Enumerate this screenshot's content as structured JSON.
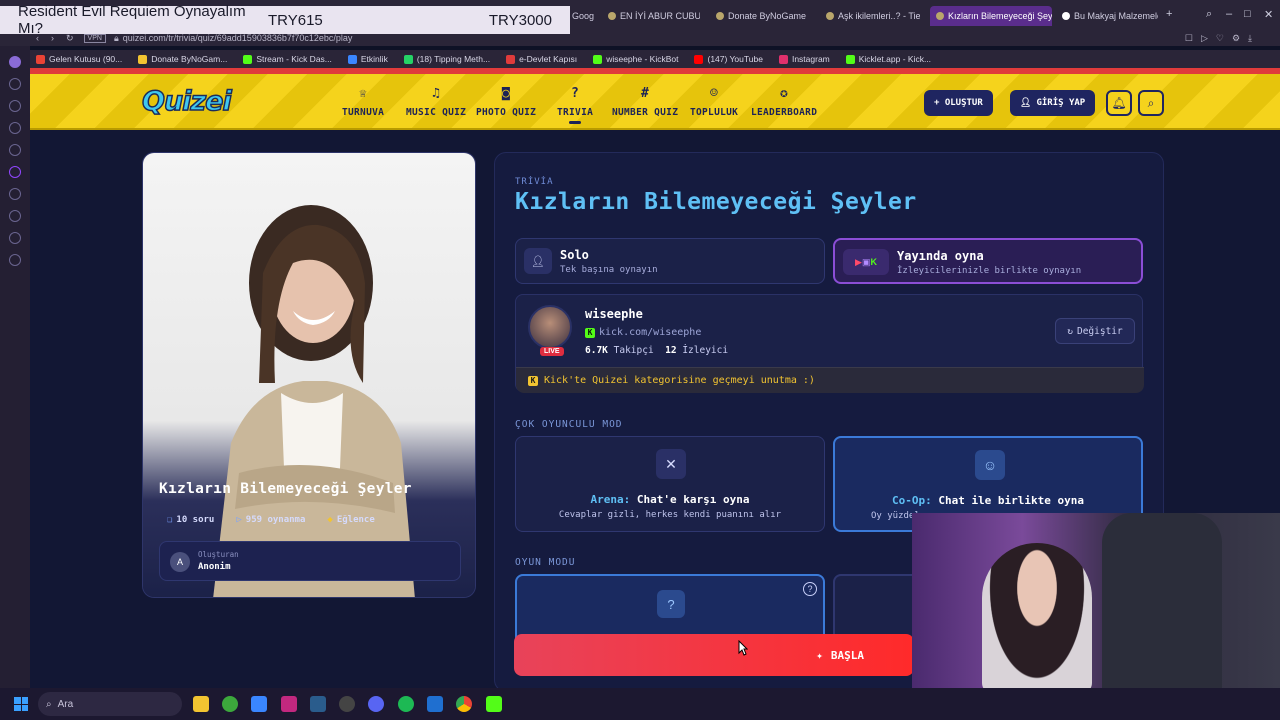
{
  "overlay": {
    "title": "Resident Evil Requiem Oynayalım Mı?",
    "price1": "TRY615",
    "price2": "TRY3000"
  },
  "tabs": [
    {
      "label": "Goog"
    },
    {
      "label": "EN İYİ ABUR CUBUR"
    },
    {
      "label": "Donate ByNoGame"
    },
    {
      "label": "Aşk ikilemleri..? - Tie"
    },
    {
      "label": "Kızların Bilemeyeceği Şey"
    },
    {
      "label": "Bu Makyaj Malzemeleri"
    }
  ],
  "address": {
    "vpn": "VPN",
    "url": "quizei.com/tr/trivia/quiz/69add15903836b7f70c12ebc/play"
  },
  "bookmarks": [
    {
      "label": "Gelen Kutusu (90...",
      "color": "#ea4335"
    },
    {
      "label": "Donate ByNoGam...",
      "color": "#f2c431"
    },
    {
      "label": "Stream - Kick Das...",
      "color": "#53fc18"
    },
    {
      "label": "Etkinlik",
      "color": "#3a86ff"
    },
    {
      "label": "(18) Tipping Meth...",
      "color": "#25d366"
    },
    {
      "label": "e-Devlet Kapısı",
      "color": "#e03b3b"
    },
    {
      "label": "wiseephe - KickBot",
      "color": "#53fc18"
    },
    {
      "label": "(147) YouTube",
      "color": "#ff0000"
    },
    {
      "label": "Instagram",
      "color": "#e1306c"
    },
    {
      "label": "Kicklet.app - Kick...",
      "color": "#53fc18"
    }
  ],
  "nav": {
    "logo": "Quizei",
    "items": [
      {
        "label": "TURNUVA",
        "icon": "trophy-icon"
      },
      {
        "label": "MUSIC QUIZ",
        "icon": "music-icon"
      },
      {
        "label": "PHOTO QUIZ",
        "icon": "camera-icon"
      },
      {
        "label": "TRIVIA",
        "icon": "question-bubble-icon"
      },
      {
        "label": "NUMBER QUIZ",
        "icon": "hash-icon"
      },
      {
        "label": "TOPLULUK",
        "icon": "people-icon"
      },
      {
        "label": "LEADERBOARD",
        "icon": "medal-icon"
      }
    ],
    "create": "+ OLUŞTUR",
    "login": "GİRİŞ YAP"
  },
  "cover": {
    "title": "Kızların Bilemeyeceği Şeyler",
    "questions": "10 soru",
    "plays": "959 oynanma",
    "category": "Eğlence",
    "creator_label": "Oluşturan",
    "creator_name": "Anonim",
    "creator_initial": "A"
  },
  "panel": {
    "category": "TRİVİA",
    "title": "Kızların Bilemeyeceği Şeyler",
    "solo_title": "Solo",
    "solo_sub": "Tek başına oynayın",
    "stream_title": "Yayında oyna",
    "stream_sub": "İzleyicilerinizle birlikte oynayın"
  },
  "streamer": {
    "name": "wiseephe",
    "link": "kick.com/wiseephe",
    "followers": "6.7K",
    "followers_label": "Takipçi",
    "viewers": "12",
    "viewers_label": "İzleyici",
    "live": "LIVE",
    "switch": "Değiştir",
    "notice": "Kick'te Quizei kategorisine geçmeyi unutma :)"
  },
  "multiplayer": {
    "label": "ÇOK OYUNCULU MOD",
    "arena_title": "Arena:",
    "arena_rest": " Chat'e karşı oyna",
    "arena_sub": "Cevaplar gizli, herkes kendi puanını alır",
    "coop_title": "Co-Op:",
    "coop_rest": " Chat ile birlikte oyna",
    "coop_sub": "Oy yüzdel"
  },
  "game_mode": {
    "label": "OYUN MODU"
  },
  "start_button": "BAŞLA",
  "taskbar": {
    "search": "Ara"
  },
  "colors": {
    "accent": "#f5d31c",
    "title": "#5fc0f5",
    "start": "#e8435a"
  }
}
